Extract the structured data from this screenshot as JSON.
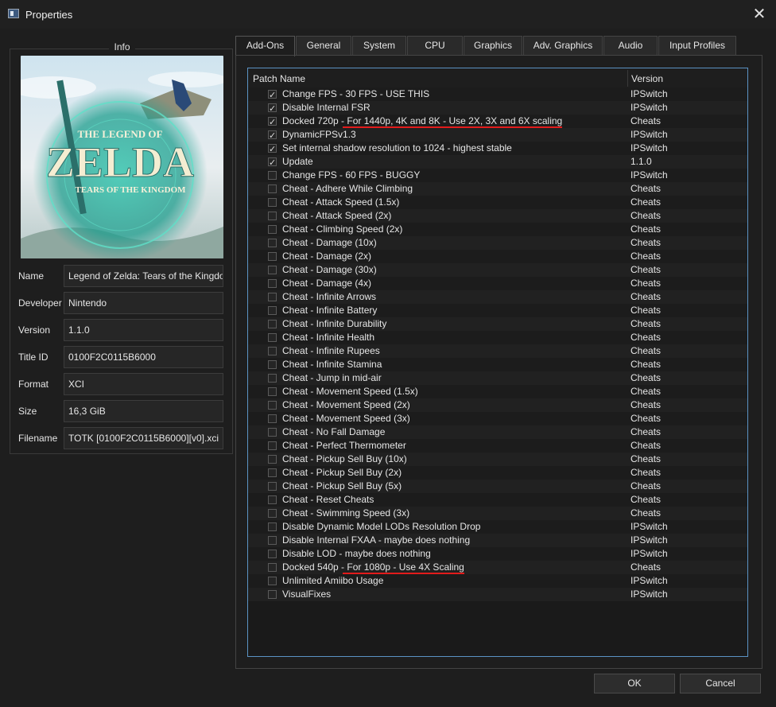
{
  "window": {
    "title": "Properties"
  },
  "info": {
    "legend": "Info",
    "cover_art": {
      "line1": "THE LEGEND OF",
      "line2": "ZELDA",
      "line3": "TEARS OF THE KINGDOM"
    },
    "fields": [
      {
        "label": "Name",
        "value": "Legend of Zelda: Tears of the Kingdom"
      },
      {
        "label": "Developer",
        "value": "Nintendo"
      },
      {
        "label": "Version",
        "value": "1.1.0"
      },
      {
        "label": "Title ID",
        "value": "0100F2C0115B6000"
      },
      {
        "label": "Format",
        "value": "XCI"
      },
      {
        "label": "Size",
        "value": "16,3 GiB"
      },
      {
        "label": "Filename",
        "value": "TOTK [0100F2C0115B6000][v0].xci"
      }
    ]
  },
  "tabs": [
    {
      "label": "Add-Ons",
      "active": true
    },
    {
      "label": "General",
      "active": false
    },
    {
      "label": "System",
      "active": false
    },
    {
      "label": "CPU",
      "active": false
    },
    {
      "label": "Graphics",
      "active": false
    },
    {
      "label": "Adv. Graphics",
      "active": false
    },
    {
      "label": "Audio",
      "active": false
    },
    {
      "label": "Input Profiles",
      "active": false
    }
  ],
  "table": {
    "headers": {
      "name": "Patch Name",
      "version": "Version"
    },
    "rows": [
      {
        "checked": true,
        "name": "Change FPS - 30 FPS - USE THIS",
        "version": "IPSwitch"
      },
      {
        "checked": true,
        "name": "Disable Internal FSR",
        "version": "IPSwitch"
      },
      {
        "checked": true,
        "name": "Docked 720p - For 1440p, 4K and 8K - Use 2X, 3X and 6X scaling",
        "version": "Cheats",
        "underlined": true
      },
      {
        "checked": true,
        "name": "DynamicFPSv1.3",
        "version": "IPSwitch"
      },
      {
        "checked": true,
        "name": "Set internal shadow resolution to 1024 - highest stable",
        "version": "IPSwitch"
      },
      {
        "checked": true,
        "name": "Update",
        "version": "1.1.0"
      },
      {
        "checked": false,
        "name": "Change FPS - 60 FPS - BUGGY",
        "version": "IPSwitch"
      },
      {
        "checked": false,
        "name": "Cheat - Adhere While Climbing",
        "version": "Cheats"
      },
      {
        "checked": false,
        "name": "Cheat - Attack Speed (1.5x)",
        "version": "Cheats"
      },
      {
        "checked": false,
        "name": "Cheat - Attack Speed (2x)",
        "version": "Cheats"
      },
      {
        "checked": false,
        "name": "Cheat - Climbing Speed (2x)",
        "version": "Cheats"
      },
      {
        "checked": false,
        "name": "Cheat - Damage (10x)",
        "version": "Cheats"
      },
      {
        "checked": false,
        "name": "Cheat - Damage (2x)",
        "version": "Cheats"
      },
      {
        "checked": false,
        "name": "Cheat - Damage (30x)",
        "version": "Cheats"
      },
      {
        "checked": false,
        "name": "Cheat - Damage (4x)",
        "version": "Cheats"
      },
      {
        "checked": false,
        "name": "Cheat - Infinite Arrows",
        "version": "Cheats"
      },
      {
        "checked": false,
        "name": "Cheat - Infinite Battery",
        "version": "Cheats"
      },
      {
        "checked": false,
        "name": "Cheat - Infinite Durability",
        "version": "Cheats"
      },
      {
        "checked": false,
        "name": "Cheat - Infinite Health",
        "version": "Cheats"
      },
      {
        "checked": false,
        "name": "Cheat - Infinite Rupees",
        "version": "Cheats"
      },
      {
        "checked": false,
        "name": "Cheat - Infinite Stamina",
        "version": "Cheats"
      },
      {
        "checked": false,
        "name": "Cheat - Jump in mid-air",
        "version": "Cheats"
      },
      {
        "checked": false,
        "name": "Cheat - Movement Speed (1.5x)",
        "version": "Cheats"
      },
      {
        "checked": false,
        "name": "Cheat - Movement Speed (2x)",
        "version": "Cheats"
      },
      {
        "checked": false,
        "name": "Cheat - Movement Speed (3x)",
        "version": "Cheats"
      },
      {
        "checked": false,
        "name": "Cheat - No Fall Damage",
        "version": "Cheats"
      },
      {
        "checked": false,
        "name": "Cheat - Perfect Thermometer",
        "version": "Cheats"
      },
      {
        "checked": false,
        "name": "Cheat - Pickup Sell Buy (10x)",
        "version": "Cheats"
      },
      {
        "checked": false,
        "name": "Cheat - Pickup Sell Buy (2x)",
        "version": "Cheats"
      },
      {
        "checked": false,
        "name": "Cheat - Pickup Sell Buy (5x)",
        "version": "Cheats"
      },
      {
        "checked": false,
        "name": "Cheat - Reset Cheats",
        "version": "Cheats"
      },
      {
        "checked": false,
        "name": "Cheat - Swimming Speed (3x)",
        "version": "Cheats"
      },
      {
        "checked": false,
        "name": "Disable Dynamic Model LODs Resolution Drop",
        "version": "IPSwitch"
      },
      {
        "checked": false,
        "name": "Disable Internal FXAA - maybe does nothing",
        "version": "IPSwitch"
      },
      {
        "checked": false,
        "name": "Disable LOD - maybe does nothing",
        "version": "IPSwitch"
      },
      {
        "checked": false,
        "name": "Docked 540p - For 1080p - Use 4X Scaling",
        "version": "Cheats",
        "underlined": true
      },
      {
        "checked": false,
        "name": "Unlimited Amiibo Usage",
        "version": "IPSwitch"
      },
      {
        "checked": false,
        "name": "VisualFixes",
        "version": "IPSwitch"
      }
    ]
  },
  "buttons": {
    "ok": "OK",
    "cancel": "Cancel"
  },
  "colors": {
    "background": "#1e1e1e",
    "table_border_accent": "#5b93c4",
    "annotation_underline": "#e21b1b"
  },
  "icons": {
    "window": "app-window-icon",
    "close": "close-icon"
  }
}
